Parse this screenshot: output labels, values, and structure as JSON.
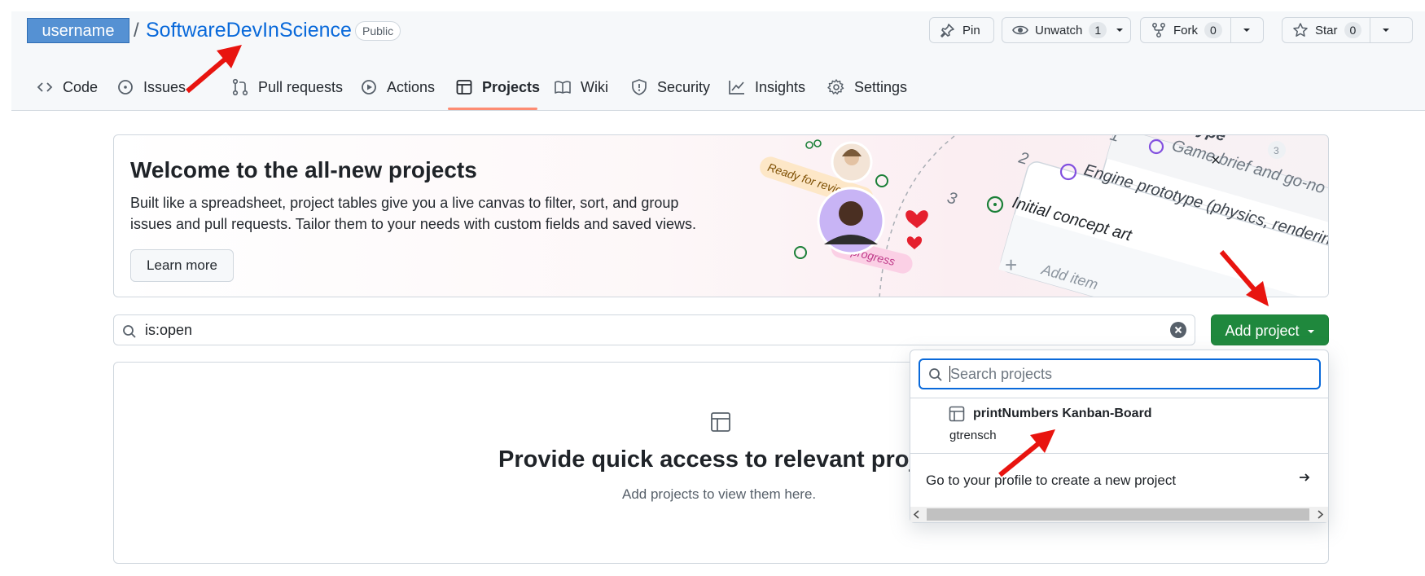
{
  "repo": {
    "owner": "username",
    "separator": "/",
    "name": "SoftwareDevInScience",
    "visibility": "Public"
  },
  "header_actions": {
    "pin": "Pin",
    "unwatch": "Unwatch",
    "unwatch_count": "1",
    "fork": "Fork",
    "fork_count": "0",
    "star": "Star",
    "star_count": "0"
  },
  "tabs": [
    {
      "label": "Code",
      "icon": "code-icon"
    },
    {
      "label": "Issues",
      "icon": "issue-opened-icon"
    },
    {
      "label": "Pull requests",
      "icon": "git-pull-request-icon"
    },
    {
      "label": "Actions",
      "icon": "play-icon"
    },
    {
      "label": "Projects",
      "icon": "table-icon",
      "selected": true
    },
    {
      "label": "Wiki",
      "icon": "book-icon"
    },
    {
      "label": "Security",
      "icon": "shield-icon"
    },
    {
      "label": "Insights",
      "icon": "graph-icon"
    },
    {
      "label": "Settings",
      "icon": "gear-icon"
    }
  ],
  "banner": {
    "title": "Welcome to the all-new projects",
    "text": "Built like a spreadsheet, project tables give you a live canvas to filter, sort, and group issues and pull requests. Tailor them to your needs with custom fields and saved views.",
    "learn_more": "Learn more",
    "illustration": {
      "ready_for_review": "Ready for review",
      "in_progress": "In progress",
      "row1_num": "1",
      "row1_text": "Game brief and go-no",
      "row2_num": "2",
      "row2_text": "Engine prototype (physics, renderin",
      "row3_num": "3",
      "row3_text": "Initial concept art",
      "add_item": "Add item",
      "top_fragment": "ype",
      "top_badge": "3"
    }
  },
  "search": {
    "value": "is:open"
  },
  "add_project_label": "Add project",
  "empty_state": {
    "title": "Provide quick access to relevant proje",
    "text": "Add projects to view them here."
  },
  "dropdown": {
    "search_placeholder": "Search projects",
    "item_name": "printNumbers Kanban-Board",
    "item_owner": "gtrensch",
    "profile_link": "Go to your profile to create a new project"
  },
  "colors": {
    "accent": "#0969da",
    "primary_button": "#1f883d",
    "tab_underline": "#fd8c73",
    "annotation_arrow": "#e8140f"
  }
}
